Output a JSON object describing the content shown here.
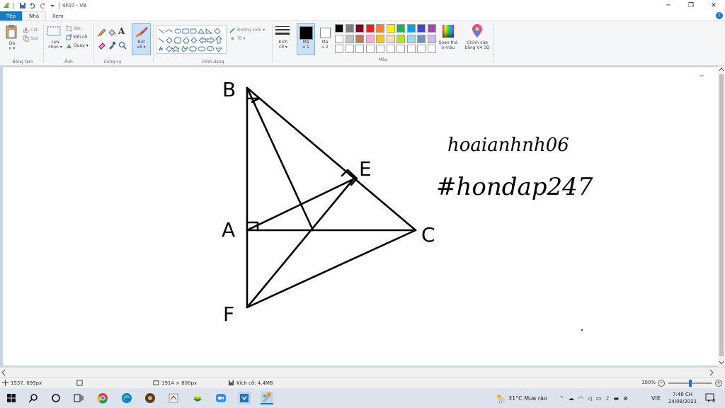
{
  "app": {
    "title": "4F07 - V8",
    "window_controls": {
      "minimize": "─",
      "restore": "❐",
      "close": "✕"
    }
  },
  "tabs": [
    {
      "label": "Tệp"
    },
    {
      "label": "Nhà"
    },
    {
      "label": "Xem"
    }
  ],
  "help": "?",
  "ribbon": {
    "clipboard": {
      "paste_line1": "Dá",
      "paste_line2": "n ▾",
      "cut": "Cắt",
      "copy": "Sao",
      "group": "Bảng tạm"
    },
    "image": {
      "select_line1": "Lựa",
      "select_line2": "chọn ▾",
      "crop": "Xén",
      "resize": "Đổi cỡ",
      "rotate": "Quay ▾",
      "group": "Ảnh"
    },
    "tools": {
      "text_glyph": "A",
      "group": "Công cụ"
    },
    "brushes": {
      "line1": "Bút",
      "line2": "vẽ ▾"
    },
    "shapes": {
      "outline": "Đường viền ▾",
      "fill": "Tô ▾",
      "group": "Hình dạng"
    },
    "size": {
      "line1": "Kích",
      "line2": "cỡ ▾"
    },
    "color1": {
      "line1": "Má",
      "line2": "u 1",
      "value": "#000000"
    },
    "color2": {
      "line1": "Má",
      "line2": "u 2",
      "value": "#ffffff"
    },
    "edit_colors": {
      "line1": "Soạn thả",
      "line2": "o màu"
    },
    "paint3d": {
      "line1": "Chỉnh sửa",
      "line2": "bằng V4 3D"
    },
    "colors_group": "Màu",
    "palette_row1": [
      "#000000",
      "#7f7f7f",
      "#880015",
      "#ed1c24",
      "#ff7f27",
      "#fff200",
      "#22b14c",
      "#00a2e8",
      "#3f48cc",
      "#a349a4"
    ],
    "palette_row2": [
      "#ffffff",
      "#c3c3c3",
      "#b97a57",
      "#ffaec9",
      "#ffc90e",
      "#efe4b0",
      "#b5e61d",
      "#99d9ea",
      "#7092be",
      "#c8bfe7"
    ],
    "palette_row3": [
      "#ffffff",
      "#ffffff",
      "#ffffff",
      "#ffffff",
      "#ffffff",
      "#ffffff",
      "#ffffff",
      "#ffffff",
      "#ffffff",
      "#ffffff"
    ]
  },
  "drawing": {
    "labels": {
      "B": "B",
      "A": "A",
      "E": "E",
      "C": "C",
      "F": "F"
    },
    "handwriting_line1": "hoaianhnh06",
    "handwriting_line2": "#hondap247"
  },
  "status": {
    "cursor_pos": "1537, 699px",
    "image_size": "1914 × 800px",
    "file_size": "Kích cỡ: 4,4MB",
    "zoom": "100%"
  },
  "taskbar": {
    "weather": "31°C  Mưa rào",
    "language": "VIE",
    "time": "7:48 CH",
    "date": "24/08/2021",
    "notifications": "8"
  }
}
